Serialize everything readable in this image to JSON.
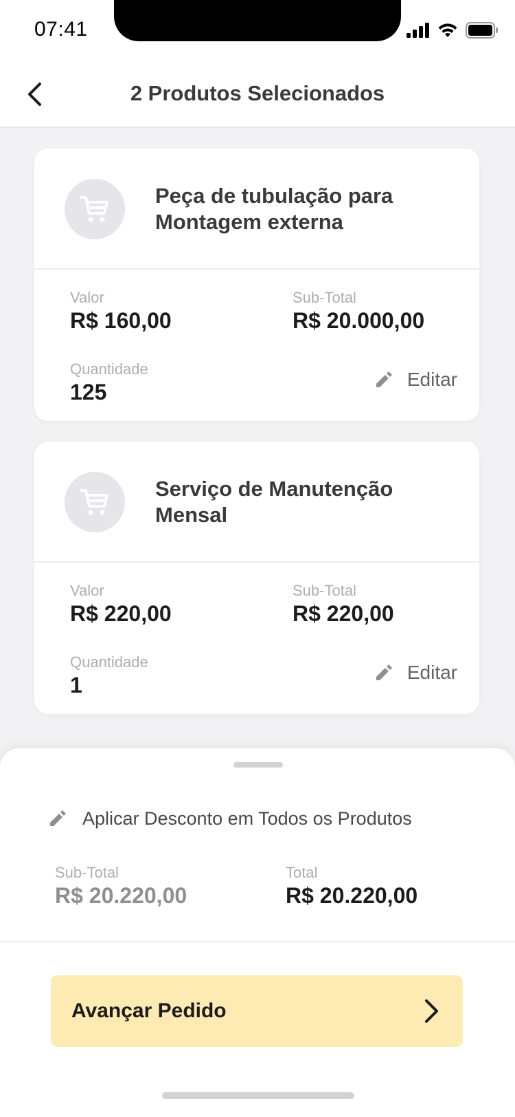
{
  "status_bar": {
    "time": "07:41"
  },
  "header": {
    "title": "2 Produtos Selecionados"
  },
  "products": [
    {
      "name": "Peça de tubulação para Montagem externa",
      "valor_label": "Valor",
      "valor": "R$ 160,00",
      "subtotal_label": "Sub-Total",
      "subtotal": "R$ 20.000,00",
      "quantidade_label": "Quantidade",
      "quantidade": "125",
      "edit_label": "Editar"
    },
    {
      "name": "Serviço de Manutenção Mensal",
      "valor_label": "Valor",
      "valor": "R$ 220,00",
      "subtotal_label": "Sub-Total",
      "subtotal": "R$ 220,00",
      "quantidade_label": "Quantidade",
      "quantidade": "1",
      "edit_label": "Editar"
    }
  ],
  "summary": {
    "discount_label": "Aplicar Desconto em Todos os Produtos",
    "subtotal_label": "Sub-Total",
    "subtotal_value": "R$ 20.220,00",
    "total_label": "Total",
    "total_value": "R$ 20.220,00",
    "cta_label": "Avançar Pedido"
  },
  "colors": {
    "cta_background": "#fdebb3",
    "avatar_background": "#e5e5ea",
    "muted_text": "#aeaeb2"
  },
  "icons": {
    "back": "chevron-left-icon",
    "product": "cart-icon",
    "edit": "pencil-icon",
    "cta": "chevron-right-icon"
  }
}
